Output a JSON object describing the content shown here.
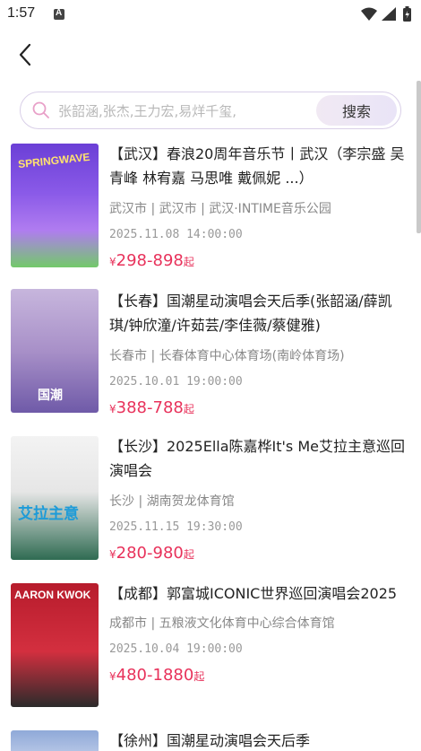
{
  "status_bar": {
    "time": "1:57",
    "notification_icon": "A"
  },
  "header": {
    "back_icon": "chevron-left"
  },
  "search": {
    "placeholder": "张韶涵,张杰,王力宏,易烊千玺,",
    "button_label": "搜索"
  },
  "colors": {
    "price": "#e8325b",
    "search_border": "#d9cfe8",
    "accent": "#e8a0c8"
  },
  "events": [
    {
      "title": "【武汉】春浪20周年音乐节丨武汉（李宗盛 吴青峰 林宥嘉 马思唯 戴佩妮 ...）",
      "venue": "武汉市 | 武汉市 | 武汉·INTIME音乐公园",
      "datetime": "2025.11.08 14:00:00",
      "currency": "¥",
      "price": "298-898",
      "price_suffix": "起",
      "poster_text": "SPRINGWAVE"
    },
    {
      "title": "【长春】国潮星动演唱会天后季(张韶涵/薛凯琪/钟欣潼/许茹芸/李佳薇/蔡健雅)",
      "venue": "长春市 | 长春体育中心体育场(南岭体育场)",
      "datetime": "2025.10.01 19:00:00",
      "currency": "¥",
      "price": "388-788",
      "price_suffix": "起",
      "poster_text": "国潮"
    },
    {
      "title": "【长沙】2025Ella陈嘉桦It's Me艾拉主意巡回演唱会",
      "venue": "长沙 | 湖南贺龙体育馆",
      "datetime": "2025.11.15 19:30:00",
      "currency": "¥",
      "price": "280-980",
      "price_suffix": "起",
      "poster_text": "艾拉主意"
    },
    {
      "title": "【成都】郭富城ICONIC世界巡回演唱会2025",
      "venue": "成都市 | 五粮液文化体育中心综合体育馆",
      "datetime": "2025.10.04 19:00:00",
      "currency": "¥",
      "price": "480-1880",
      "price_suffix": "起",
      "poster_text": "AARON KWOK"
    },
    {
      "title": "【徐州】国潮星动演唱会天后季",
      "venue": "",
      "datetime": "",
      "currency": "",
      "price": "",
      "price_suffix": "",
      "poster_text": ""
    }
  ]
}
